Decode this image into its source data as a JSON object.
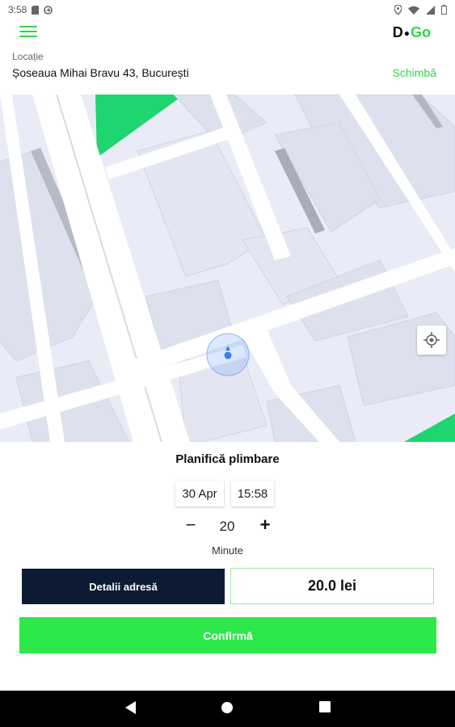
{
  "status_bar": {
    "time": "3:58"
  },
  "app": {
    "logo_left": "D",
    "logo_right": "Go"
  },
  "location": {
    "label": "Locație",
    "address": "Șoseaua Mihai Bravu 43, București",
    "change_label": "Schimbă"
  },
  "planner": {
    "title": "Planifică plimbare",
    "date": "30 Apr",
    "time": "15:58",
    "minus_label": "−",
    "duration": "20",
    "plus_label": "+",
    "duration_unit": "Minute",
    "details_button": "Detalii adresă",
    "price": "20.0 lei",
    "confirm_button": "Confirmă"
  },
  "colors": {
    "accent": "#2dd84a",
    "dark_button": "#0c1a33",
    "map_background": "#e9ecf6",
    "park": "#1ed56f"
  },
  "icons": {
    "menu": "hamburger-icon",
    "locate": "crosshair-icon",
    "back": "back-triangle-icon",
    "home": "home-circle-icon",
    "recents": "recents-square-icon"
  }
}
